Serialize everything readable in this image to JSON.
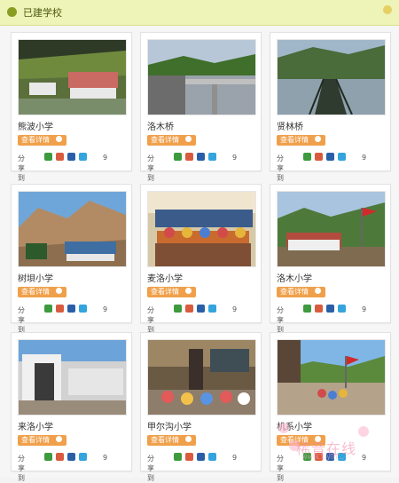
{
  "section": {
    "title": "已建学校"
  },
  "schools": [
    {
      "name": "熊波小学",
      "detail_label": "查看详情",
      "share_label": "分享到",
      "share_count": "9"
    },
    {
      "name": "洛木桥",
      "detail_label": "查看详情",
      "share_label": "分享到",
      "share_count": "9"
    },
    {
      "name": "贤林桥",
      "detail_label": "查看详情",
      "share_label": "分享到",
      "share_count": "9"
    },
    {
      "name": "树垻小学",
      "detail_label": "查看详情",
      "share_label": "分享到",
      "share_count": "9"
    },
    {
      "name": "麦洛小学",
      "detail_label": "查看详情",
      "share_label": "分享到",
      "share_count": "9"
    },
    {
      "name": "洛木小学",
      "detail_label": "查看详情",
      "share_label": "分享到",
      "share_count": "9"
    },
    {
      "name": "来洛小学",
      "detail_label": "查看详情",
      "share_label": "分享到",
      "share_count": "9"
    },
    {
      "name": "甲尔沟小学",
      "detail_label": "查看详情",
      "share_label": "分享到",
      "share_count": "9"
    },
    {
      "name": "机系小学",
      "detail_label": "查看详情",
      "share_label": "分享到",
      "share_count": "9"
    }
  ],
  "watermark": {
    "text": "稀音在线",
    "url": "www.xiyin..."
  },
  "colors": {
    "header_bg": "#eef3b7",
    "accent_orange": "#f0a04b",
    "card_bg": "#ffffff",
    "share_green": "#3d9a3d",
    "share_red": "#d95b3e",
    "share_blue": "#2a5fa8",
    "share_cyan": "#34a4dd"
  }
}
